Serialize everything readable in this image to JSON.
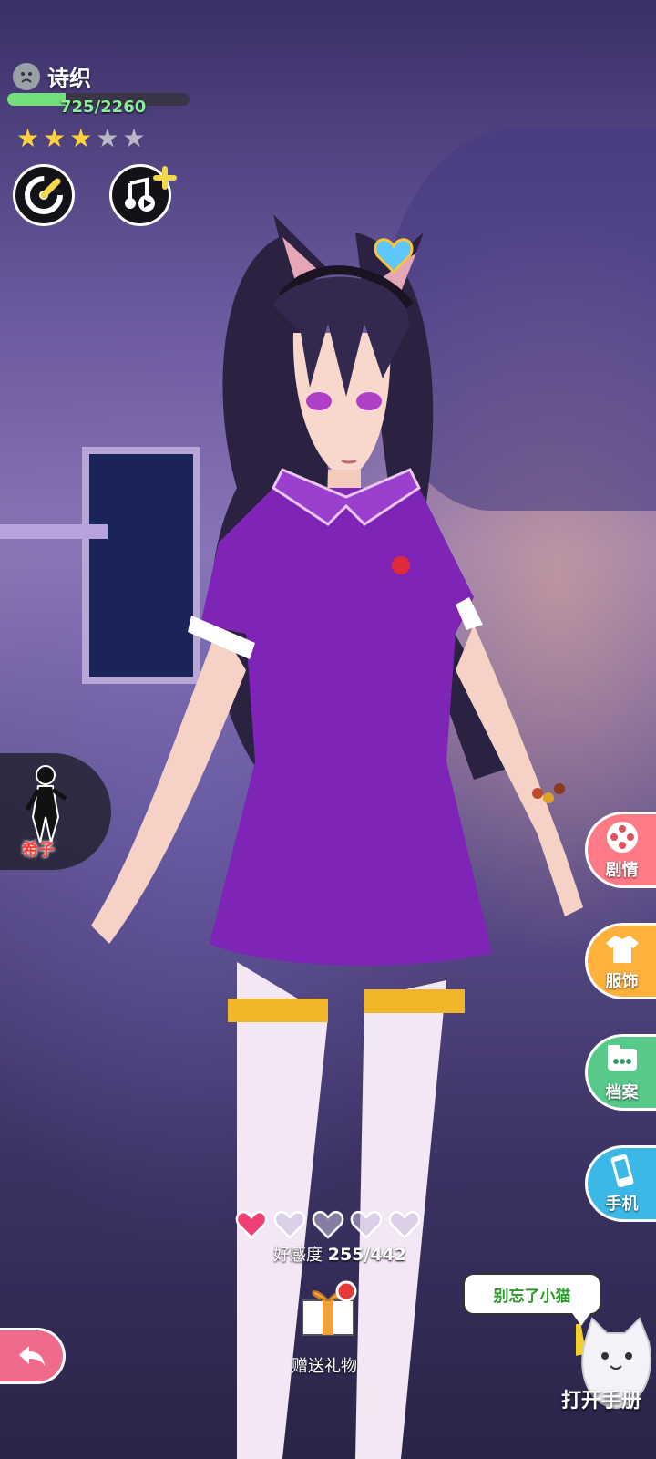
{
  "character": {
    "name": "诗织",
    "exp_text": "725/2260",
    "exp_progress": 0.321,
    "stars_total": 5,
    "stars_filled": 3,
    "mood_icon": "sad-face-icon"
  },
  "top_buttons": [
    {
      "icon": "gauge-icon"
    },
    {
      "icon": "music-add-icon"
    }
  ],
  "left_tab": {
    "label": "希子",
    "icon": "character-silhouette-icon"
  },
  "side_menu": [
    {
      "label": "剧情",
      "icon": "film-reel-icon",
      "color": "#ff7a86"
    },
    {
      "label": "服饰",
      "icon": "clothes-icon",
      "color": "#ffb13c"
    },
    {
      "label": "档案",
      "icon": "chat-folder-icon",
      "color": "#57c98a"
    },
    {
      "label": "手机",
      "icon": "phone-icon",
      "color": "#3bb8e6"
    }
  ],
  "affection": {
    "label": "好感度",
    "value_text": "255/442",
    "hearts_total": 5,
    "hearts_filled": 1
  },
  "gift": {
    "label": "赠送礼物",
    "icon": "gift-box-icon"
  },
  "back_button": {
    "icon": "back-arrow-icon",
    "color": "#f06a8c"
  },
  "cat_bubble": {
    "text": "别忘了小猫"
  },
  "handbook": {
    "label": "打开手册",
    "icon": "cat-icon"
  }
}
